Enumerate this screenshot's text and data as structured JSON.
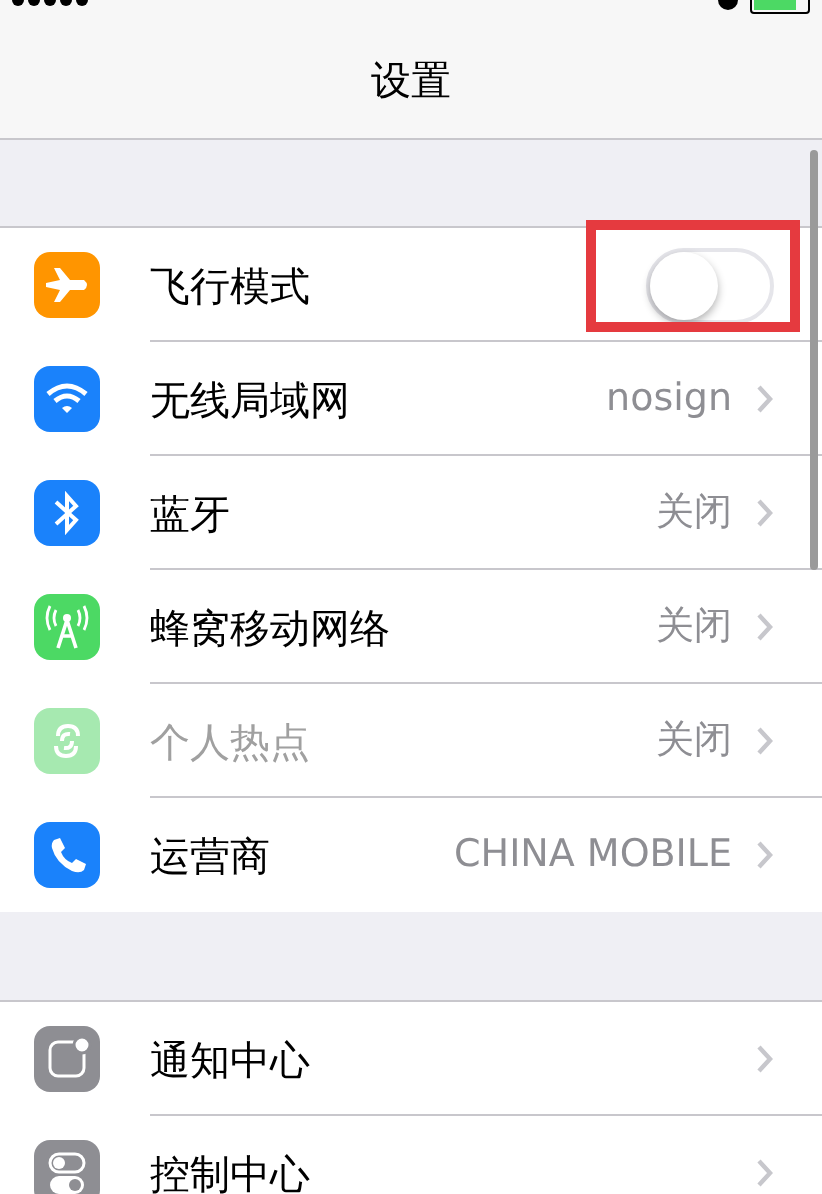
{
  "nav_bar": {
    "title": "设置"
  },
  "groups": [
    {
      "items": [
        {
          "kind": "toggle",
          "label": "飞行模式",
          "on": false,
          "highlighted": true
        },
        {
          "kind": "link",
          "label": "无线局域网",
          "value": "nosign",
          "disabled": false
        },
        {
          "kind": "link",
          "label": "蓝牙",
          "value": "关闭",
          "disabled": false
        },
        {
          "kind": "link",
          "label": "蜂窝移动网络",
          "value": "关闭",
          "disabled": false
        },
        {
          "kind": "link",
          "label": "个人热点",
          "value": "关闭",
          "disabled": true
        },
        {
          "kind": "link",
          "label": "运营商",
          "value": "CHINA MOBILE",
          "disabled": false
        }
      ]
    },
    {
      "items": [
        {
          "kind": "link",
          "label": "通知中心",
          "disabled": false
        },
        {
          "kind": "link",
          "label": "控制中心",
          "disabled": false
        }
      ]
    }
  ]
}
